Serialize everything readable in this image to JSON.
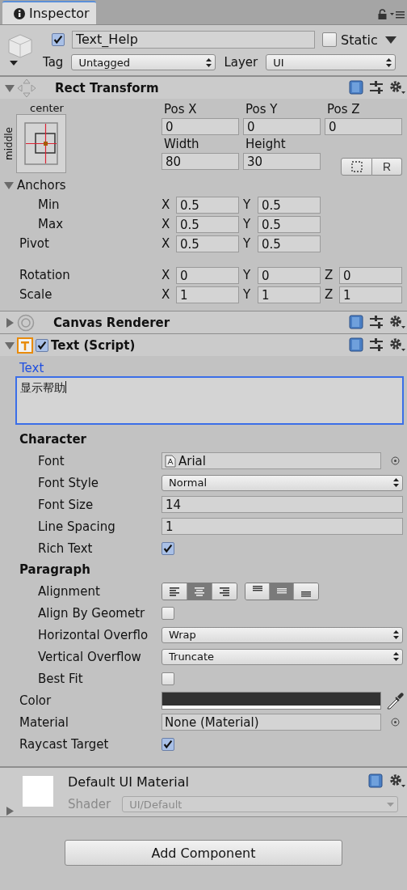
{
  "tab": {
    "title": "Inspector"
  },
  "object": {
    "active": true,
    "name": "Text_Help",
    "static": false,
    "static_label": "Static",
    "tag_label": "Tag",
    "tag": "Untagged",
    "layer_label": "Layer",
    "layer": "UI"
  },
  "components": [
    {
      "kind": "rect_transform",
      "title": "Rect Transform",
      "expanded": true,
      "anchor_preset": {
        "horizontal": "center",
        "vertical": "middle"
      },
      "position": [
        {
          "label": "Pos X",
          "value": "0"
        },
        {
          "label": "Pos Y",
          "value": "0"
        },
        {
          "label": "Pos Z",
          "value": "0"
        }
      ],
      "size": [
        {
          "label": "Width",
          "value": "80"
        },
        {
          "label": "Height",
          "value": "30"
        }
      ],
      "raw_button": "R",
      "anchors": {
        "label": "Anchors",
        "expanded": true,
        "children": [
          {
            "label": "Min",
            "fields": [
              {
                "axis": "X",
                "value": "0.5"
              },
              {
                "axis": "Y",
                "value": "0.5"
              }
            ]
          },
          {
            "label": "Max",
            "fields": [
              {
                "axis": "X",
                "value": "0.5"
              },
              {
                "axis": "Y",
                "value": "0.5"
              }
            ]
          }
        ]
      },
      "pivot": {
        "label": "Pivot",
        "fields": [
          {
            "axis": "X",
            "value": "0.5"
          },
          {
            "axis": "Y",
            "value": "0.5"
          }
        ]
      },
      "transform_rows": [
        {
          "label": "Rotation",
          "fields": [
            {
              "axis": "X",
              "value": "0"
            },
            {
              "axis": "Y",
              "value": "0"
            },
            {
              "axis": "Z",
              "value": "0"
            }
          ]
        },
        {
          "label": "Scale",
          "fields": [
            {
              "axis": "X",
              "value": "1"
            },
            {
              "axis": "Y",
              "value": "1"
            },
            {
              "axis": "Z",
              "value": "1"
            }
          ]
        }
      ]
    },
    {
      "kind": "canvas_renderer",
      "title": "Canvas Renderer",
      "expanded": false
    },
    {
      "kind": "text",
      "title": "Text (Script)",
      "expanded": true,
      "enabled": true,
      "text_label": "Text",
      "text_value": "显示帮助",
      "focused": true,
      "properties": [
        {
          "kind": "header",
          "label": "Character",
          "children": [
            {
              "kind": "object",
              "label": "Font",
              "value": "Arial"
            },
            {
              "kind": "dropdown",
              "label": "Font Style",
              "value": "Normal"
            },
            {
              "kind": "field",
              "label": "Font Size",
              "value": "14"
            },
            {
              "kind": "field",
              "label": "Line Spacing",
              "value": "1"
            },
            {
              "kind": "checkbox",
              "label": "Rich Text",
              "checked": true
            }
          ]
        },
        {
          "kind": "header",
          "label": "Paragraph",
          "children": [
            {
              "kind": "alignment",
              "label": "Alignment",
              "horizontal": [
                {
                  "selected": false
                },
                {
                  "selected": true
                },
                {
                  "selected": false
                }
              ],
              "vertical": [
                {
                  "selected": false
                },
                {
                  "selected": true
                },
                {
                  "selected": false
                }
              ]
            },
            {
              "kind": "checkbox",
              "label": "Align By Geometr",
              "checked": false
            },
            {
              "kind": "dropdown",
              "label": "Horizontal Overflo",
              "value": "Wrap"
            },
            {
              "kind": "dropdown",
              "label": "Vertical Overflow",
              "value": "Truncate"
            },
            {
              "kind": "checkbox",
              "label": "Best Fit",
              "checked": false
            }
          ]
        },
        {
          "kind": "color",
          "label": "Color",
          "color": "#323232"
        },
        {
          "kind": "object",
          "label": "Material",
          "value": "None (Material)",
          "no_icon": true
        },
        {
          "kind": "checkbox",
          "label": "Raycast Target",
          "checked": true
        }
      ]
    },
    {
      "kind": "material",
      "title": "Default UI Material",
      "shader_label": "Shader",
      "shader": "UI/Default"
    }
  ],
  "add_component": "Add Component"
}
